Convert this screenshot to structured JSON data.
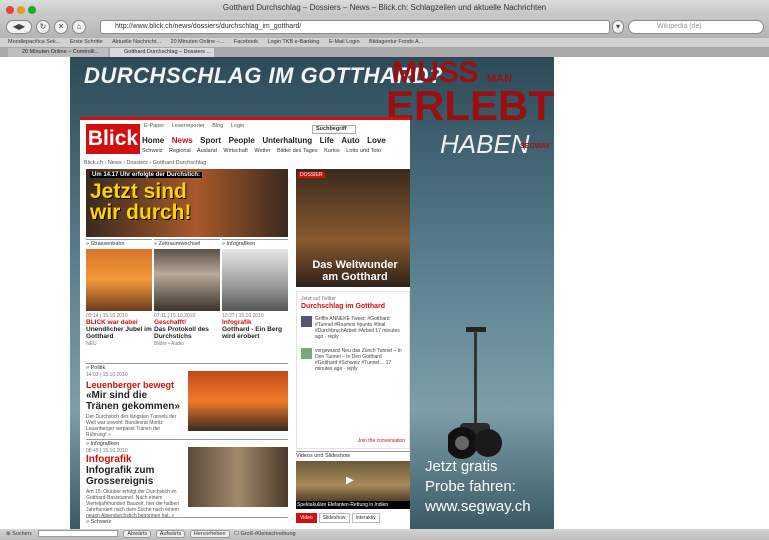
{
  "window": {
    "title": "Gotthard Durchschlag – Dossiers – News – Blick.ch: Schlagzeilen und aktuelle Nachrichten",
    "url": "http://www.blick.ch/news/dossiers/durchschlag_im_gotthard/",
    "search_placeholder": "Wikipedia (de)"
  },
  "bookmarks": [
    "Moodlepacifica Sek...",
    "Erste Schritte",
    "Aktuelle Nachricht...",
    "20 Minuten Online –...",
    "Facebook",
    "Login TKB e-Banking",
    "E-Mail Login",
    "Bildagentur Fonds A..."
  ],
  "tabs": [
    {
      "label": "20 Minuten Online – Comtrolli..."
    },
    {
      "label": "Gotthard Durchschlag – Dossiers ..."
    }
  ],
  "ad": {
    "headline": "DURCHSCHLAG IM GOTTHARD?",
    "muss": "MUSS",
    "man": "MAN",
    "erlebt": "ERLEBT",
    "haben": "HABEN",
    "brand": "SEGWAY",
    "cta_lines": [
      "Jetzt gratis",
      "Probe fahren:",
      "www.segway.ch"
    ]
  },
  "site": {
    "logo": "Blick",
    "util": [
      "E-Paper",
      "Leserreporter",
      "Blog",
      "Login"
    ],
    "search_button": "Suchbegriff",
    "nav": [
      "Home",
      "News",
      "Sport",
      "People",
      "Unterhaltung",
      "Life",
      "Auto",
      "Love"
    ],
    "subnav": [
      "Schweiz",
      "Regional",
      "Ausland",
      "Wirtschaft",
      "Wetter",
      "Bilder des Tages",
      "Kurios",
      "Lotto und Toto"
    ],
    "breadcrumb": "Blick.ch › News › Dossiers › Gotthard Durchschlag",
    "hero": {
      "kicker": "Um 14.17 Uhr erfolgte der Durchstich:",
      "headline_1": "Jetzt sind",
      "headline_2": "wir durch!"
    },
    "columns": [
      {
        "tag": "» Strassenbahn",
        "date": "05:14 | 15.10.2010",
        "title_red": "BLICK war dabei",
        "title_black": "Unendlicher Jubel im Gotthard",
        "meta": "NEU"
      },
      {
        "tag": "» Zeitraumwechsel",
        "date": "07:11 | 15.10.2010",
        "title_red": "Geschafft!",
        "title_black": "Das Protokoll des Durchstichs",
        "meta": "Bilder • Audio"
      },
      {
        "tag": "» Infografiken",
        "date": "10:37 | 15.10.2010",
        "title_red": "Infografik",
        "title_black": "Gotthard - Ein Berg wird erobert",
        "meta": ""
      }
    ],
    "dossier": {
      "label": "DOSSIER",
      "title": "Das Weltwunder am Gotthard"
    },
    "twitter": {
      "kicker": "Jetzt auf Twitter",
      "title": "Durchschlag im Gotthard",
      "items": [
        "Griffin ANNEKE Tweet: #Gotthard #Tunnel #Rosmos #punta #final #DurchbruchArbeit #Arbeit 17 minutes ago · reply",
        "vorgewusst Neu das Zürich Tunnel – In Den Tunnel – In Den Gotthard #Gotthard #Schweiz #Tunnel… 17 minutes ago · reply"
      ],
      "footer": "Join the conversation"
    },
    "videos": {
      "heading": "Videos und Slideshow",
      "caption": "Spektakuläre Elefanten-Rettung in Indien",
      "tabs": [
        "Video",
        "Slideshow",
        "Interaktiv"
      ]
    },
    "stories": [
      {
        "section": "» Politik",
        "date": "14:03 | 15.10.2010",
        "title_red": "Leuenberger bewegt",
        "title_black": "«Mir sind die Tränen gekommen»",
        "text": "Der Durchstich des längsten Tunnels der Welt war sowohl: Bundesrat Moritz Leuenberger verpasst Tränen der Rührung! »"
      },
      {
        "section": "» Infografiken",
        "date": "08:45 | 15.10.2010",
        "title_red": "Infografik",
        "title_black": "Infografik zum Grossereignis",
        "text": "Am 15. Oktober erfolgt der Durchstich im Gotthard-Basistunnel. Nach einem Vierteljahrhundert Bauzeit, hier die halben Jahrhundert nach dem Suche nach einem neuen Alpendurchstich begonnen hat. »"
      },
      {
        "section": "» Schweiz",
        "date": "",
        "title_red": "",
        "title_black": "",
        "text": ""
      }
    ]
  },
  "statusbar": {
    "label": "Suchen:",
    "buttons": [
      "Abwärts",
      "Aufwärts",
      "Hervorheben"
    ],
    "check": "Groß-/Kleinschreibung"
  }
}
